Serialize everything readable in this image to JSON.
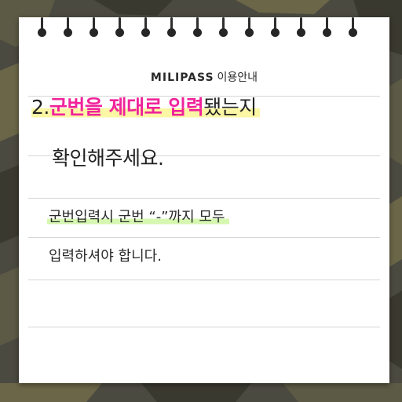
{
  "header": {
    "brand": "MILIPASS",
    "subtitle": "이용안내"
  },
  "notice": {
    "number": "2.",
    "highlight": "군번을 제대로 입력",
    "title_rest": "됐는지",
    "title_line2": "확인해주세요.",
    "body_line1": "군번입력시 군번 “-”까지 모두",
    "body_line2": "입력하셔야 합니다."
  },
  "colors": {
    "highlight_pink": "#f0239a",
    "highlight_yellow": "#fbf7a4",
    "highlight_green": "#d6f7b0",
    "camouflage": [
      "#4b4a40",
      "#5c5a45",
      "#6b6648",
      "#3a392f"
    ]
  },
  "icons": [
    "binder-ring-icon"
  ]
}
